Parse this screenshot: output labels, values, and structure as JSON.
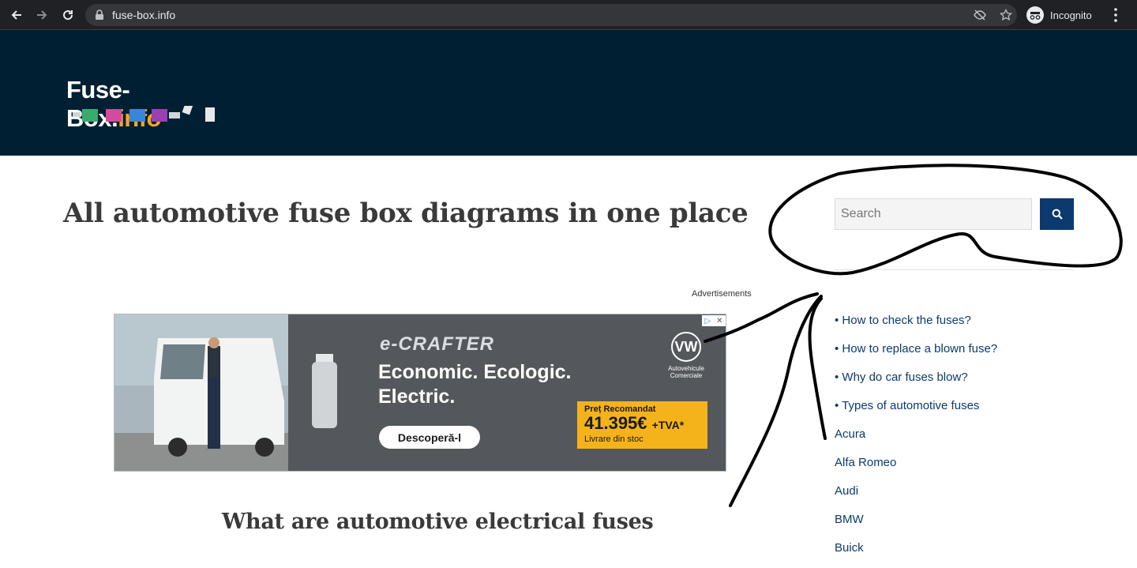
{
  "browser": {
    "url": "fuse-box.info",
    "profile_label": "Incognito"
  },
  "site": {
    "logo_main": "Fuse-Box.",
    "logo_suffix": "info"
  },
  "main": {
    "title": "All automotive fuse box diagrams in one place",
    "section_title": "What are automotive electrical fuses"
  },
  "search": {
    "placeholder": "Search"
  },
  "ad": {
    "label": "Advertisements",
    "brand": "e-CRAFTER",
    "headline": "Economic. Ecologic. Electric.",
    "cta": "Descoperă-l",
    "price_label": "Preț Recomandat",
    "price_value": "41.395€",
    "price_suffix": "+TVA*",
    "price_note": "Livrare din stoc",
    "vw_mark": "VW",
    "vw_caption": "Autovehicule Comerciale"
  },
  "sidebar": {
    "items": [
      {
        "label": "• How to check the fuses?"
      },
      {
        "label": "• How to replace a blown fuse?"
      },
      {
        "label": "• Why do car fuses blow?"
      },
      {
        "label": "• Types of automotive fuses"
      },
      {
        "label": "Acura"
      },
      {
        "label": "Alfa Romeo"
      },
      {
        "label": "Audi"
      },
      {
        "label": "BMW"
      },
      {
        "label": "Buick"
      }
    ]
  },
  "colors": {
    "header_bg": "#011f33",
    "accent": "#0b3a6e",
    "logo_accent": "#f5a623",
    "ad_price_bg": "#f5b31b"
  }
}
